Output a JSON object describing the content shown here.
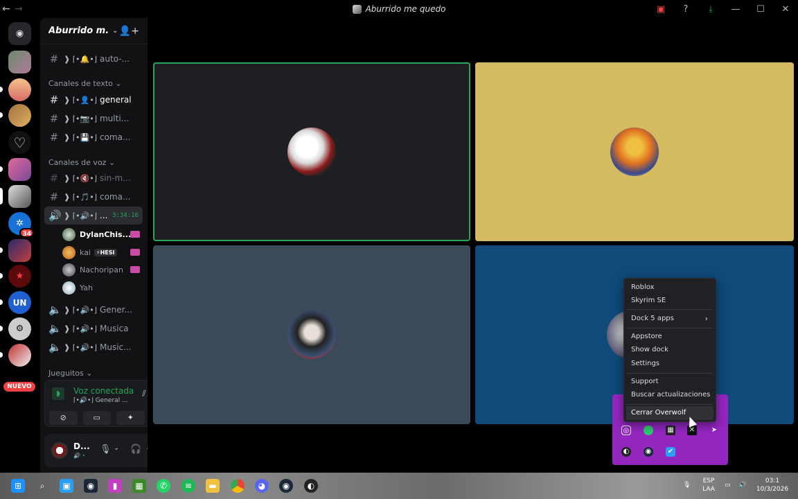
{
  "window": {
    "title": "Aburrido me quedo",
    "back": "←",
    "forward": "→",
    "controls": {
      "inbox": "▣",
      "help": "?",
      "download": "⤓",
      "minimize": "—",
      "maximize": "☐",
      "close": "✕"
    }
  },
  "guilds": {
    "nuevo_label": "NUEVO",
    "badge_count": "34",
    "discord_logo": "discord-logo"
  },
  "server": {
    "name": "Aburrido m...",
    "chevron": "⌄",
    "invite_icon": "👤+"
  },
  "channels": {
    "top": {
      "label": "auto-...",
      "deco": "❱ ⌈•🔔•⌋"
    },
    "text_category": "Canales de texto",
    "text": [
      {
        "label": "general",
        "deco": "❱ ⌈•👤•⌋"
      },
      {
        "label": "multi...",
        "deco": "❱ ⌈•📷•⌋"
      },
      {
        "label": "coma...",
        "deco": "❱ ⌈•💾•⌋"
      }
    ],
    "voice_category": "Canales de voz",
    "voice_top": [
      {
        "label": "sin-m...",
        "deco": "❱ ⌈•🔇•⌋"
      },
      {
        "label": "coma...",
        "deco": "❱ ⌈•🎵•⌋"
      }
    ],
    "active_voice": {
      "label": "...",
      "deco": "❱ ⌈•🔊•⌋",
      "timer": "3:34:16"
    },
    "voice_users": [
      {
        "name": "DylanChis...",
        "tag": ""
      },
      {
        "name": "kai",
        "tag": "⚡HESI"
      },
      {
        "name": "Nachoripan",
        "tag": ""
      },
      {
        "name": "Yah",
        "tag": ""
      }
    ],
    "voice_rest": [
      {
        "label": "Gener...",
        "deco": "❱ ⌈•🔊•⌋"
      },
      {
        "label": "Musica",
        "deco": "❱ ⌈•🔊•⌋"
      },
      {
        "label": "Music...",
        "deco": "❱ ⌈•🔊•⌋"
      }
    ],
    "games_category": "Jueguitos"
  },
  "voice_panel": {
    "status": "Voz conectada",
    "channel": "⌈•🔊•⌋ General ..."
  },
  "user": {
    "name": "D...",
    "status": "🔊 •"
  },
  "context_menu": {
    "items": [
      "Roblox",
      "Skyrim SE",
      "Dock 5 apps",
      "Appstore",
      "Show dock",
      "Settings",
      "Support",
      "Buscar actualizaciones",
      "Cerrar Overwolf"
    ],
    "submenu_arrow": "›"
  },
  "taskbar": {
    "lang": "ESP",
    "lang2": "LAA",
    "time": "03:1",
    "date": "10/3/2026"
  },
  "colors": {
    "tile1": "#1e1f22",
    "tile2": "#d4ba60",
    "tile3": "#3b4a59",
    "tile4": "#0f4a7a",
    "speaking": "#23a55a",
    "tray": "#9426c0"
  }
}
